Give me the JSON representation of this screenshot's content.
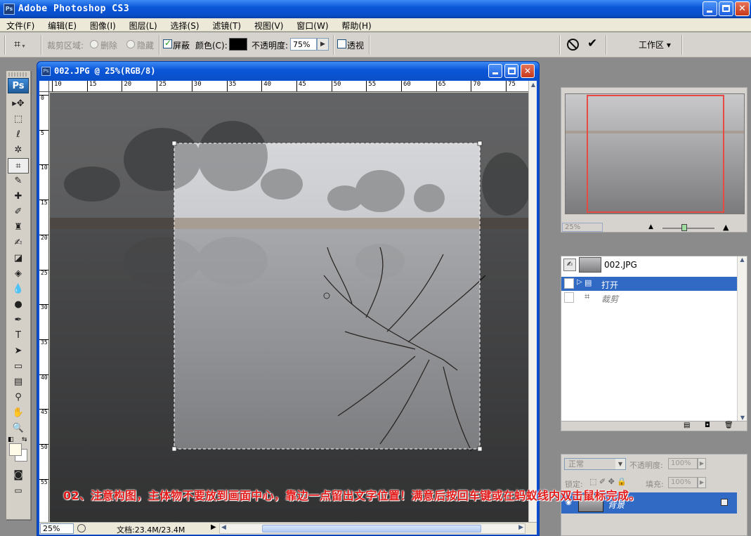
{
  "app": {
    "title": "Adobe Photoshop CS3",
    "icon": "Ps"
  },
  "menu": [
    "文件(F)",
    "编辑(E)",
    "图像(I)",
    "图层(L)",
    "选择(S)",
    "滤镜(T)",
    "视图(V)",
    "窗口(W)",
    "帮助(H)"
  ],
  "options": {
    "crop_area_label": "裁剪区域:",
    "delete_label": "删除",
    "hide_label": "隐藏",
    "shield_label": "屏蔽",
    "color_label": "颜色(C):",
    "shield_color": "#000000",
    "opacity_label": "不透明度:",
    "opacity_value": "75%",
    "perspective_label": "透视",
    "shield_checked": true,
    "perspective_checked": false,
    "workspace_label": "工作区 ▾"
  },
  "toolbox": {
    "logo": "Ps",
    "tools": [
      {
        "name": "move-tool",
        "glyph": "▸✥"
      },
      {
        "name": "marquee-tool",
        "glyph": "⬚"
      },
      {
        "name": "lasso-tool",
        "glyph": "ℓ"
      },
      {
        "name": "magic-wand-tool",
        "glyph": "✲"
      },
      {
        "name": "crop-tool",
        "glyph": "⌗"
      },
      {
        "name": "slice-tool",
        "glyph": "✎"
      },
      {
        "name": "healing-tool",
        "glyph": "✚"
      },
      {
        "name": "brush-tool",
        "glyph": "✐"
      },
      {
        "name": "stamp-tool",
        "glyph": "♜"
      },
      {
        "name": "history-brush-tool",
        "glyph": "✍"
      },
      {
        "name": "eraser-tool",
        "glyph": "◪"
      },
      {
        "name": "paint-bucket-tool",
        "glyph": "◈"
      },
      {
        "name": "blur-tool",
        "glyph": "💧"
      },
      {
        "name": "dodge-tool",
        "glyph": "●"
      },
      {
        "name": "pen-tool",
        "glyph": "✒"
      },
      {
        "name": "type-tool",
        "glyph": "T"
      },
      {
        "name": "path-select-tool",
        "glyph": "➤"
      },
      {
        "name": "shape-tool",
        "glyph": "▭"
      },
      {
        "name": "notes-tool",
        "glyph": "▤"
      },
      {
        "name": "eyedropper-tool",
        "glyph": "⚲"
      },
      {
        "name": "hand-tool",
        "glyph": "✋"
      },
      {
        "name": "zoom-tool",
        "glyph": "🔍"
      }
    ],
    "active_tool": "crop-tool",
    "foreground_color": "#fffbe8",
    "background_color": "#ffffff"
  },
  "document": {
    "title": "002.JPG @ 25%(RGB/8)",
    "zoom": "25%",
    "doc_info": "文档:23.4M/23.4M",
    "hruler_ticks": [
      "10",
      "15",
      "20",
      "25",
      "30",
      "35",
      "40",
      "45",
      "50",
      "55",
      "60",
      "65",
      "70",
      "75"
    ],
    "vruler_ticks": [
      "0",
      "5",
      "10",
      "15",
      "20",
      "25",
      "30",
      "35",
      "40",
      "45",
      "50",
      "55"
    ]
  },
  "navigator": {
    "zoom": "25%"
  },
  "history": {
    "snapshot": "002.JPG",
    "items": [
      {
        "label": "打开",
        "selected": true
      },
      {
        "label": "裁剪",
        "selected": false
      }
    ]
  },
  "layers": {
    "blend_mode": "正常",
    "opacity_label": "不透明度:",
    "opacity_value": "100%",
    "lock_label": "锁定:",
    "fill_label": "填充:",
    "fill_value": "100%",
    "layer_name": "背景"
  },
  "caption": "02、注意构图，主体物不要放到画面中心，靠边一点留出文字位置！满意后按回车键或在蚂蚁线内双击鼠标完成。"
}
